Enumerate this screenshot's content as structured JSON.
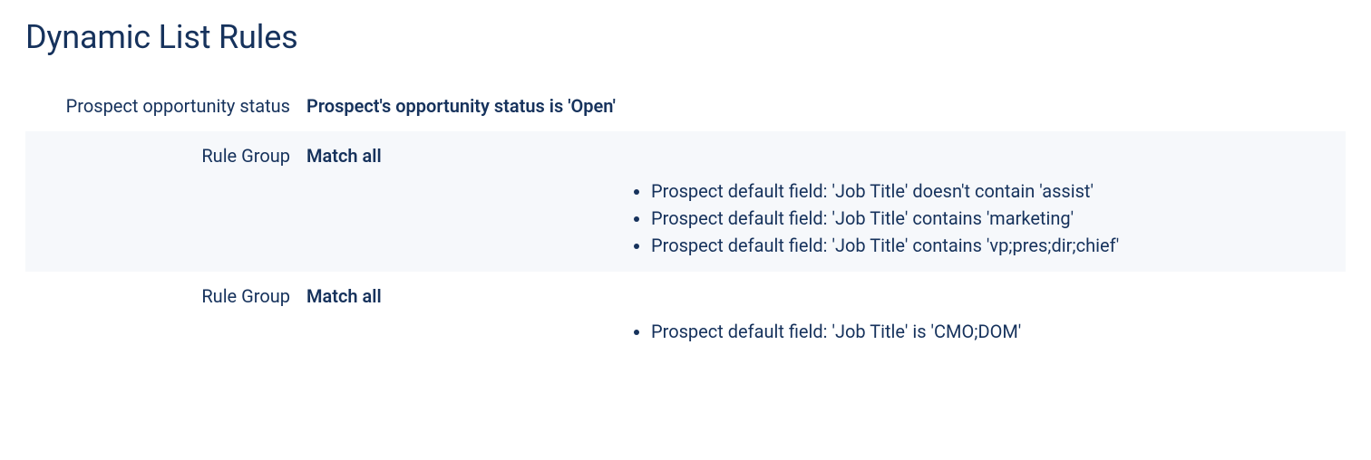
{
  "title": "Dynamic List Rules",
  "rows": [
    {
      "label": "Prospect opportunity status",
      "heading": "Prospect's opportunity status is 'Open'",
      "items": []
    },
    {
      "label": "Rule Group",
      "heading": "Match all",
      "items": [
        "Prospect default field: 'Job Title' doesn't contain 'assist'",
        "Prospect default field: 'Job Title' contains 'marketing'",
        "Prospect default field: 'Job Title' contains 'vp;pres;dir;chief'"
      ]
    },
    {
      "label": "Rule Group",
      "heading": "Match all",
      "items": [
        "Prospect default field: 'Job Title' is 'CMO;DOM'"
      ]
    }
  ]
}
